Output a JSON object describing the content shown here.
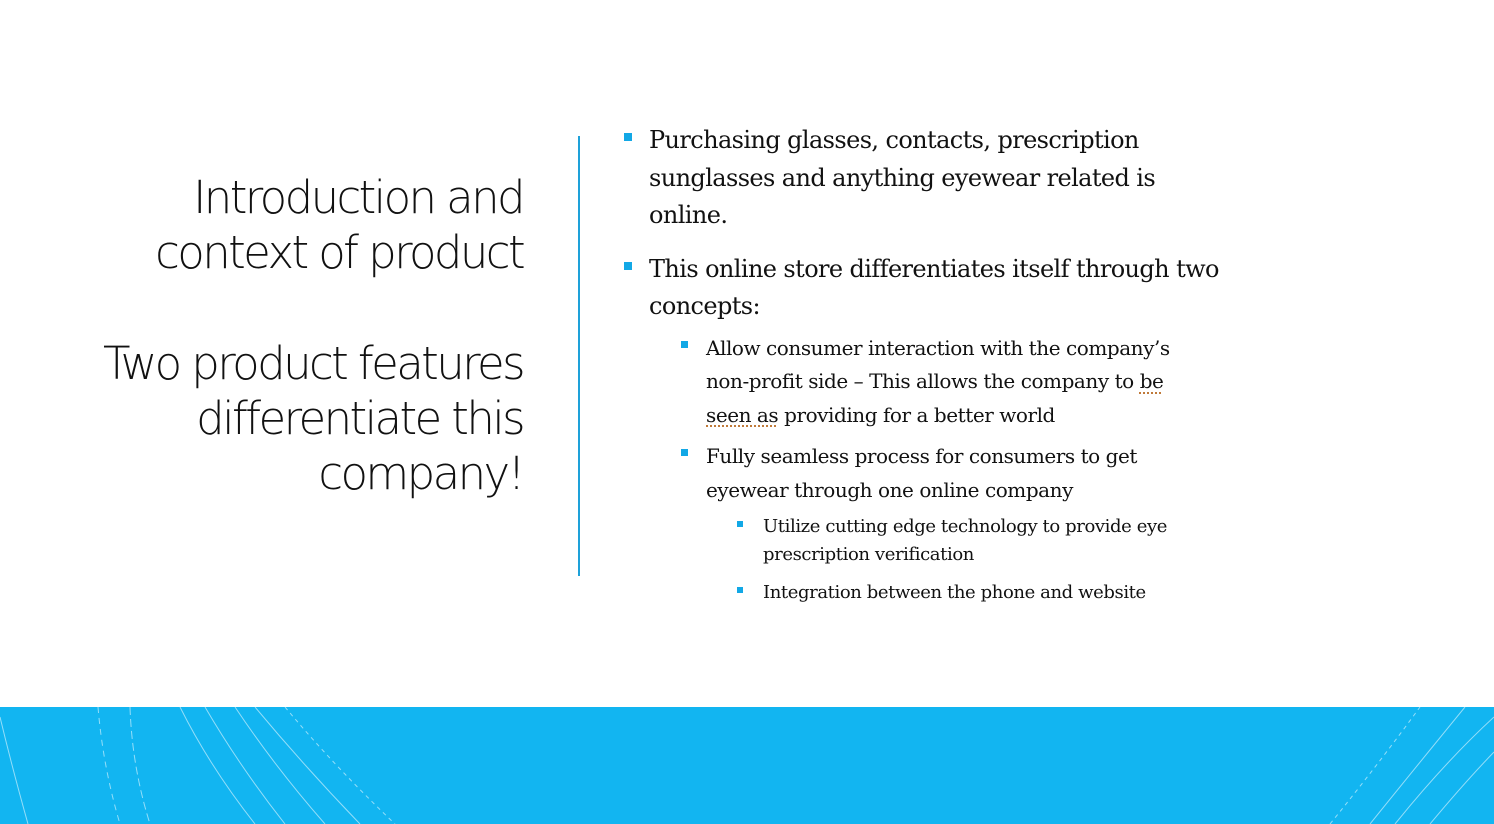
{
  "title": {
    "heading_lines": [
      "Introduction and",
      "context of product"
    ],
    "subheading_lines": [
      "Two product features",
      "differentiate this",
      "company!"
    ]
  },
  "body": {
    "bullet_1": {
      "lines": [
        "Purchasing glasses, contacts, prescription",
        "sunglasses and anything eyewear related is",
        "online."
      ]
    },
    "bullet_2": {
      "lines": [
        "This online store differentiates itself through two",
        "concepts:"
      ]
    },
    "bullet_2_1": {
      "line_1": "Allow consumer interaction with the company’s",
      "line_2_before": "non-profit side – This allows the company to ",
      "line_2_marked": "be",
      "line_3_marked": "seen as",
      "line_3_after": " providing for a better world"
    },
    "bullet_2_2": {
      "lines": [
        "Fully seamless process for consumers to get",
        "eyewear through one online company"
      ]
    },
    "bullet_2_2_1": {
      "lines": [
        "Utilize cutting edge technology to provide eye",
        "prescription verification"
      ]
    },
    "bullet_2_2_2": {
      "lines": [
        "Integration between the phone and website"
      ]
    }
  },
  "colors": {
    "accent": "#12b5f1",
    "bullet": "#12a8e6",
    "divider": "#1ea1d9",
    "text": "#111111"
  }
}
